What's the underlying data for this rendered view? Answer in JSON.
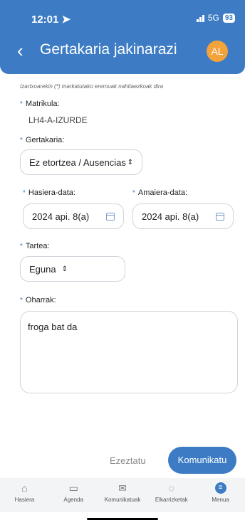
{
  "status": {
    "time": "12:01",
    "network": "5G",
    "battery": "93"
  },
  "header": {
    "title": "Gertakaria jakinarazi",
    "avatar": "AL"
  },
  "form": {
    "required_note": "Izartxoarekin (*) markatutako eremuak nahitaezkoak dira",
    "required_mark": "*",
    "plate_label": "Matrikula:",
    "plate_value": "LH4-A-IZURDE",
    "incident_label": "Gertakaria:",
    "incident_value": "Ez etortzea / Ausencias",
    "start_label": "Hasiera-data:",
    "start_value": "2024 api. 8(a)",
    "end_label": "Amaiera-data:",
    "end_value": "2024 api. 8(a)",
    "range_label": "Tartea:",
    "range_value": "Eguna",
    "notes_label": "Oharrak:",
    "notes_value": "froga bat da"
  },
  "actions": {
    "cancel": "Ezeztatu",
    "submit": "Komunikatu"
  },
  "tabbar": {
    "items": [
      {
        "label": "Hasiera",
        "icon": "home-icon"
      },
      {
        "label": "Agenda",
        "icon": "calendar-icon"
      },
      {
        "label": "Komunikatuak",
        "icon": "envelope-icon"
      },
      {
        "label": "Elkarrizketak",
        "icon": "chat-icon"
      },
      {
        "label": "Menua",
        "icon": "menu-icon"
      }
    ]
  },
  "colors": {
    "accent": "#3d7cc4",
    "avatar": "#f4a23a"
  }
}
